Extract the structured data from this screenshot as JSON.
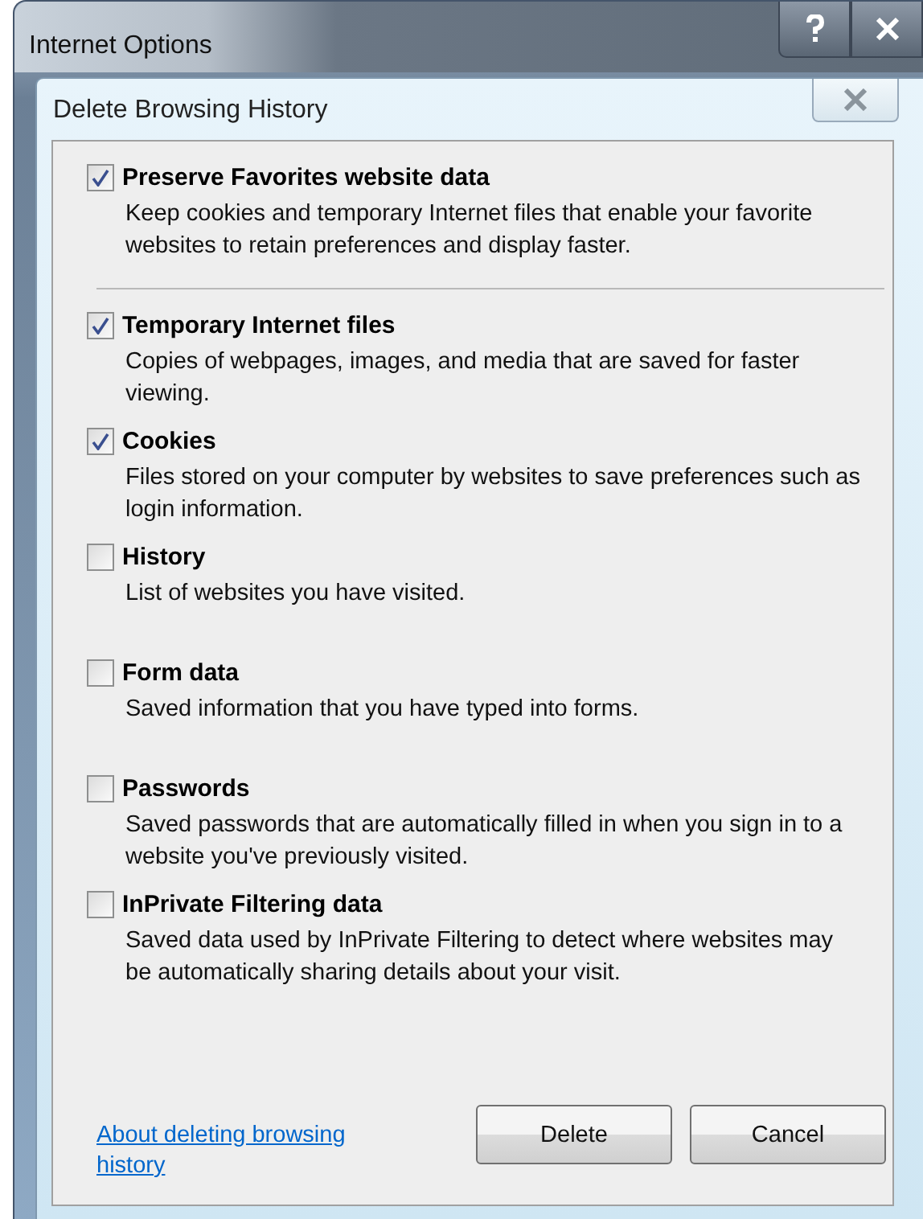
{
  "window": {
    "title": "Internet Options"
  },
  "dialog": {
    "title": "Delete Browsing History"
  },
  "options": [
    {
      "kind": "preserve",
      "label": "Preserve Favorites website data",
      "description": "Keep cookies and temporary Internet files that enable your favorite websites to retain preferences and display faster.",
      "checked": true
    },
    {
      "kind": "delete",
      "label": "Temporary Internet files",
      "description": "Copies of webpages, images, and media that are saved for faster viewing.",
      "checked": true
    },
    {
      "kind": "delete",
      "label": "Cookies",
      "description": "Files stored on your computer by websites to save preferences such as login information.",
      "checked": true
    },
    {
      "kind": "delete",
      "label": "History",
      "description": "List of websites you have visited.",
      "checked": false
    },
    {
      "kind": "delete",
      "label": "Form data",
      "description": "Saved information that you have typed into forms.",
      "checked": false
    },
    {
      "kind": "delete",
      "label": "Passwords",
      "description": "Saved passwords that are automatically filled in when you sign in to a website you've previously visited.",
      "checked": false
    },
    {
      "kind": "delete",
      "label": "InPrivate Filtering data",
      "description": "Saved data used by InPrivate Filtering to detect where websites may be automatically sharing details about your visit.",
      "checked": false
    }
  ],
  "help_link": "About deleting browsing history",
  "buttons": [
    "Delete",
    "Cancel"
  ]
}
